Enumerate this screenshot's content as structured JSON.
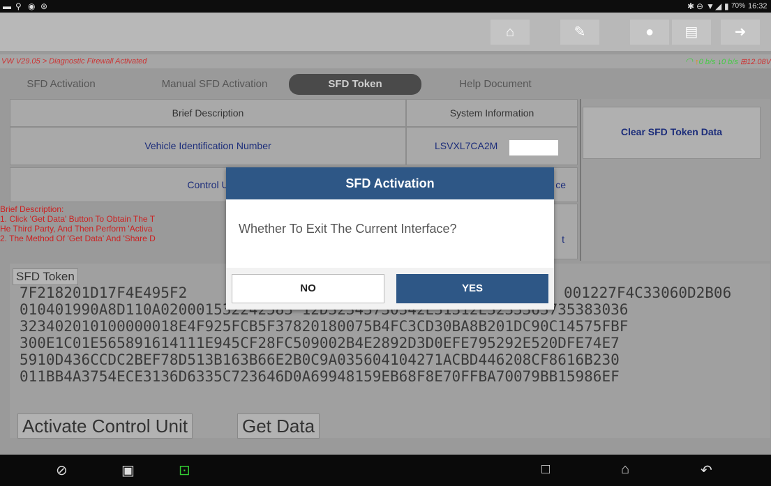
{
  "status_bar": {
    "left_icons": [
      "notification-icon",
      "usb-icon",
      "record-icon",
      "accessibility-icon"
    ],
    "battery": "70%",
    "time": "16:32"
  },
  "toolbar": {
    "buttons": [
      "home-icon",
      "edit-icon",
      "chat-icon",
      "print-icon",
      "exit-icon"
    ]
  },
  "breadcrumb": "VW V29.05 > Diagnostic Firewall Activated",
  "network": {
    "up": "0 b/s",
    "down": "0 b/s",
    "voltage": "12.08V"
  },
  "tabs": [
    {
      "label": "SFD Activation"
    },
    {
      "label": "Manual SFD Activation"
    },
    {
      "label": "SFD Token"
    },
    {
      "label": "Help Document"
    }
  ],
  "table": {
    "col1_header": "Brief Description",
    "col2_header": "System Information",
    "row1_label": "Vehicle Identification Number",
    "row1_value": "LSVXL7CA2M",
    "row2_label": "Control U",
    "row2_value": "ce",
    "row3_value": "t"
  },
  "side": {
    "clear_button": "Clear SFD Token Data"
  },
  "brief": {
    "line1": "Brief Description:",
    "line2": "1. Click 'Get Data' Button To Obtain The T",
    "line3": "He Third Party, And Then Perform 'Activa",
    "line4": "2. The Method Of 'Get Data' And 'Share D"
  },
  "token": {
    "label": "SFD Token",
    "line1": "7F218201D17F4E495F2",
    "line1_right": "001227F4C33060D2B06",
    "line2": "010401990A8D110A020001532242583 12D32343730342E31312E3233363735383036",
    "line3": "323402010100000018E4F925FCB5F37820180075B4FC3CD30BA8B201DC90C14575FBF",
    "line4": "300E1C01E565891614111E945CF28FC509002B4E2892D3D0EFE795292E520DFE74E7",
    "line5": "5910D436CCDC2BEF78D513B163B66E2B0C9A035604104271ACBD446208CF8616B230",
    "line6": "011BB4A3754ECE3136D6335C723646D0A69948159EB68F8E70FFBA70079BB15986EF"
  },
  "actions": {
    "activate": "Activate Control Unit",
    "get_data": "Get Data"
  },
  "dialog": {
    "title": "SFD Activation",
    "message": "Whether To Exit The Current Interface?",
    "no": "NO",
    "yes": "YES"
  },
  "colors": {
    "dialog_header": "#2e5786",
    "link_blue": "#1c2d7a",
    "warning_red": "#c22"
  }
}
